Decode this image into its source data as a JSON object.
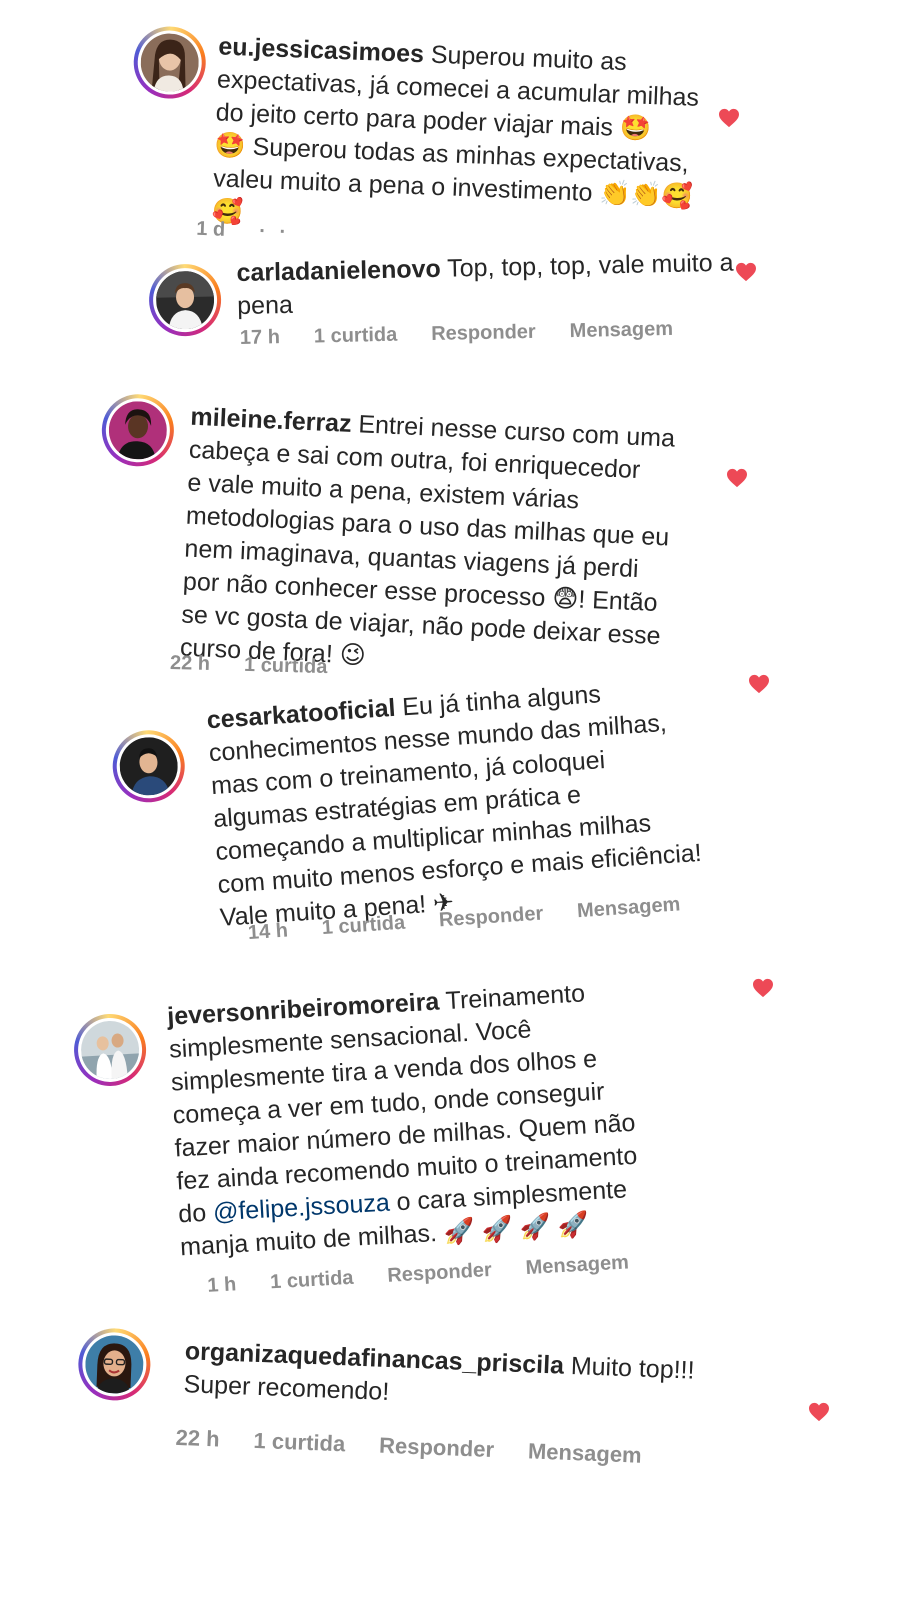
{
  "colors": {
    "heart": "#ed4956",
    "mention": "#00376b",
    "meta_gray": "#8e8e8e",
    "text": "#262626"
  },
  "comments": [
    {
      "username": "eu.jessicasimoes",
      "text": " Superou muito as\nexpectativas, já comecei a acumular milhas\ndo jeito certo para poder viajar mais 🤩\n🤩 Superou todas as minhas expectativas,\nvaleu muito a pena o investimento 👏👏🥰\n🥰",
      "time": "1 d",
      "likes": "",
      "reply": "",
      "message": ""
    },
    {
      "username": "carladanielenovo",
      "text": " Top, top, top, vale muito a\npena",
      "time": "17 h",
      "likes": "1 curtida",
      "reply": "Responder",
      "message": "Mensagem"
    },
    {
      "username": "mileine.ferraz",
      "text": " Entrei nesse curso com uma\ncabeça e sai com outra, foi enriquecedor\ne vale muito a pena, existem várias\nmetodologias para o uso das milhas que eu\nnem imaginava, quantas viagens já perdi\npor não conhecer esse processo 😨! Então\nse vc gosta de viajar, não pode deixar esse\ncurso de fora! 😉",
      "time": "22 h",
      "likes": "1 curtida",
      "reply": "",
      "message": ""
    },
    {
      "username": "cesarkatooficial",
      "text": " Eu já tinha alguns\nconhecimentos nesse mundo das milhas,\nmas com o treinamento, já coloquei\nalgumas estratégias em prática e\ncomeçando a multiplicar minhas milhas\ncom muito menos esforço e mais eficiência!\nVale muito a pena! ✈",
      "time": "14 h",
      "likes": "1 curtida",
      "reply": "Responder",
      "message": "Mensagem"
    },
    {
      "username": "jeversonribeiromoreira",
      "text_before": " Treinamento\nsimplesmente sensacional. Você\nsimplesmente tira a venda dos olhos e\ncomeça a ver em tudo, onde conseguir\nfazer maior número de milhas. Quem não\nfez ainda recomendo muito o treinamento\ndo ",
      "mention": "@felipe.jssouza",
      "text_after": " o cara simplesmente\nmanja muito de milhas. 🚀 🚀 🚀 🚀",
      "time": "1 h",
      "likes": "1 curtida",
      "reply": "Responder",
      "message": "Mensagem"
    },
    {
      "username": "organizaquedafinancas_priscila",
      "text": " Muito top!!!\nSuper recomendo!",
      "time": "22 h",
      "likes": "1 curtida",
      "reply": "Responder",
      "message": "Mensagem"
    }
  ]
}
